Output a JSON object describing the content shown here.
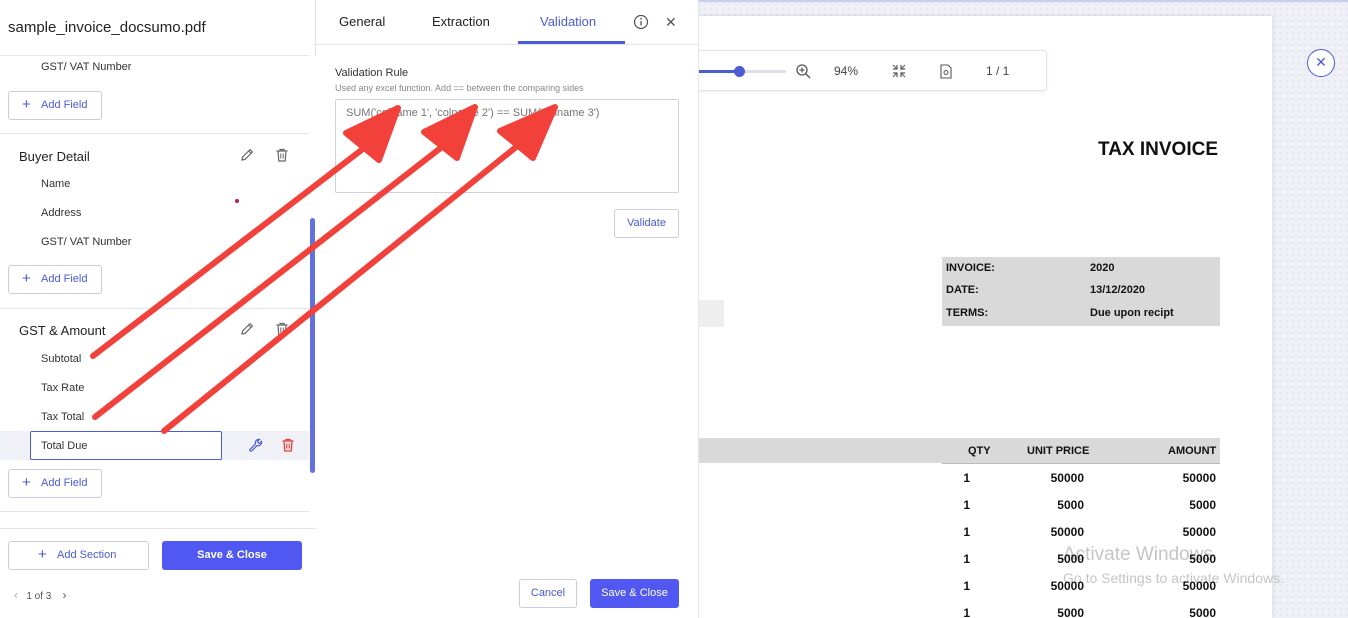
{
  "file_title": "sample_invoice_docsumo.pdf",
  "left_panel": {
    "top_fields": [
      "GST/ VAT Number"
    ],
    "add_field_label": "Add Field",
    "sections": [
      {
        "title": "Buyer Detail",
        "fields": [
          "Name",
          "Address",
          "GST/ VAT Number"
        ]
      },
      {
        "title": "GST & Amount",
        "fields": [
          "Subtotal",
          "Tax Rate",
          "Tax Total"
        ],
        "editing_field": "Total Due"
      }
    ],
    "add_section_label": "Add Section",
    "save_close_label": "Save & Close",
    "pager": "1 of 3"
  },
  "tabs": [
    {
      "label": "General"
    },
    {
      "label": "Extraction"
    },
    {
      "label": "Validation",
      "active": true
    }
  ],
  "validation": {
    "rule_label": "Validation Rule",
    "hint": "Used any excel function. Add == between the comparing sides",
    "placeholder": "SUM('colname 1', 'colname 2') == SUM('colname 3')",
    "validate_label": "Validate",
    "cancel_label": "Cancel",
    "save_close_label": "Save & Close"
  },
  "viewer": {
    "zoom_level": "94%",
    "zoom_fraction": 0.45,
    "page_indicator": "1 / 1"
  },
  "invoice": {
    "title": "TAX INVOICE",
    "info": [
      {
        "k": "INVOICE:",
        "v": "2020"
      },
      {
        "k": "DATE:",
        "v": "13/12/2020"
      },
      {
        "k": "TERMS:",
        "v": "Due upon recipt"
      }
    ],
    "columns": [
      "QTY",
      "UNIT PRICE",
      "AMOUNT"
    ],
    "rows": [
      [
        "1",
        "50000",
        "50000"
      ],
      [
        "1",
        "5000",
        "5000"
      ],
      [
        "1",
        "50000",
        "50000"
      ],
      [
        "1",
        "5000",
        "5000"
      ],
      [
        "1",
        "50000",
        "50000"
      ],
      [
        "1",
        "5000",
        "5000"
      ]
    ]
  },
  "watermark": {
    "line1": "Activate Windows",
    "line2": "Go to Settings to activate Windows."
  },
  "colors": {
    "accent": "#4a5bd6",
    "primary_button": "#5158f2",
    "annotation": "#f2403a"
  }
}
